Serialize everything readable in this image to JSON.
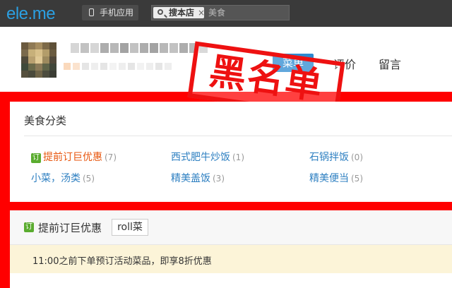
{
  "topbar": {
    "logo": "ele.me",
    "mobile_app_label": "手机应用",
    "search": {
      "tag_label": "搜本店",
      "clear": "×",
      "placeholder": "美食"
    }
  },
  "header": {
    "nav": {
      "menu": "菜单",
      "review": "评价",
      "message": "留言"
    },
    "stamp_text": "黑名单"
  },
  "categories": {
    "title": "美食分类",
    "items": [
      {
        "icon": "订",
        "label": "提前订巨优惠",
        "count": "(7)"
      },
      {
        "label": "西式肥牛炒饭",
        "count": "(1)"
      },
      {
        "label": "石锅拌饭",
        "count": "(0)"
      },
      {
        "label": "小菜，汤类",
        "count": "(5)"
      },
      {
        "label": "精美盖饭",
        "count": "(3)"
      },
      {
        "label": "精美便当",
        "count": "(5)"
      }
    ]
  },
  "section": {
    "icon": "订",
    "title": "提前订巨优惠",
    "roll_button": "roll菜",
    "notice": "11:00之前下单预订活动菜品，即享8折优惠"
  },
  "colors": {
    "brand_blue": "#2ba0e3",
    "accent_red": "#ff0000",
    "link_blue": "#2d7fc1",
    "highlight_orange": "#e8560e"
  }
}
